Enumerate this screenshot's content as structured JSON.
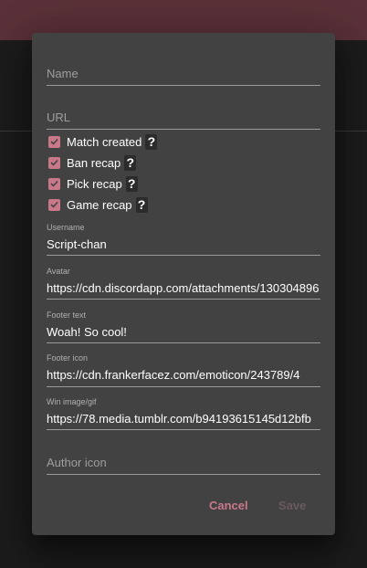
{
  "dialog": {
    "name_field": {
      "placeholder": "Name",
      "value": ""
    },
    "url_field": {
      "placeholder": "URL",
      "value": ""
    },
    "checkboxes": [
      {
        "label": "Match created",
        "checked": true,
        "help": "?"
      },
      {
        "label": "Ban recap",
        "checked": true,
        "help": "?"
      },
      {
        "label": "Pick recap",
        "checked": true,
        "help": "?"
      },
      {
        "label": "Game recap",
        "checked": true,
        "help": "?"
      }
    ],
    "username": {
      "label": "Username",
      "value": "Script-chan"
    },
    "avatar": {
      "label": "Avatar",
      "value": "https://cdn.discordapp.com/attachments/130304896"
    },
    "footer_text": {
      "label": "Footer text",
      "value": "Woah! So cool!"
    },
    "footer_icon": {
      "label": "Footer icon",
      "value": "https://cdn.frankerfacez.com/emoticon/243789/4"
    },
    "win_image": {
      "label": "Win image/gif",
      "value": "https://78.media.tumblr.com/b94193615145d12bfb"
    },
    "author_icon": {
      "placeholder": "Author icon",
      "value": ""
    },
    "buttons": {
      "cancel": "Cancel",
      "save": "Save"
    }
  },
  "colors": {
    "accent": "#c9788a",
    "topbar": "#5a3138",
    "dialog_bg": "#424242",
    "save_disabled": "#6a5a5d"
  }
}
